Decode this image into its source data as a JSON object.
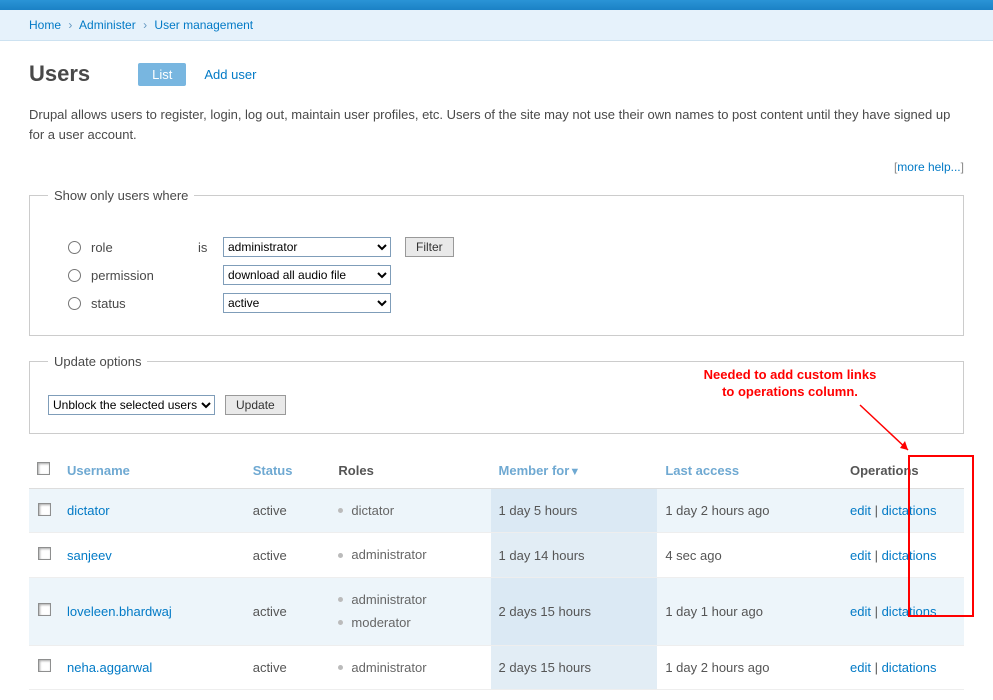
{
  "breadcrumb": {
    "home": "Home",
    "admin": "Administer",
    "usermgmt": "User management"
  },
  "page_title": "Users",
  "tabs": {
    "list": "List",
    "add": "Add user"
  },
  "description": "Drupal allows users to register, login, log out, maintain user profiles, etc. Users of the site may not use their own names to post content until they have signed up for a user account.",
  "more_help": "more help...",
  "filter": {
    "legend": "Show only users where",
    "is": "is",
    "role_label": "role",
    "permission_label": "permission",
    "status_label": "status",
    "role_value": "administrator",
    "permission_value": "download all audio file",
    "status_value": "active",
    "filter_btn": "Filter"
  },
  "update": {
    "legend": "Update options",
    "select_value": "Unblock the selected users",
    "update_btn": "Update"
  },
  "columns": {
    "username": "Username",
    "status": "Status",
    "roles": "Roles",
    "member": "Member for",
    "last": "Last access",
    "ops": "Operations"
  },
  "ops_edit": "edit",
  "ops_custom": "dictations",
  "rows": [
    {
      "user": "dictator",
      "status": "active",
      "roles": [
        "dictator"
      ],
      "member": "1 day 5 hours",
      "last": "1 day 2 hours ago"
    },
    {
      "user": "sanjeev",
      "status": "active",
      "roles": [
        "administrator"
      ],
      "member": "1 day 14 hours",
      "last": "4 sec ago"
    },
    {
      "user": "loveleen.bhardwaj",
      "status": "active",
      "roles": [
        "administrator",
        "moderator"
      ],
      "member": "2 days 15 hours",
      "last": "1 day 1 hour ago"
    },
    {
      "user": "neha.aggarwal",
      "status": "active",
      "roles": [
        "administrator"
      ],
      "member": "2 days 15 hours",
      "last": "1 day 2 hours ago"
    }
  ],
  "annotation": {
    "line1": "Needed to add custom links",
    "line2": "to operations column."
  }
}
